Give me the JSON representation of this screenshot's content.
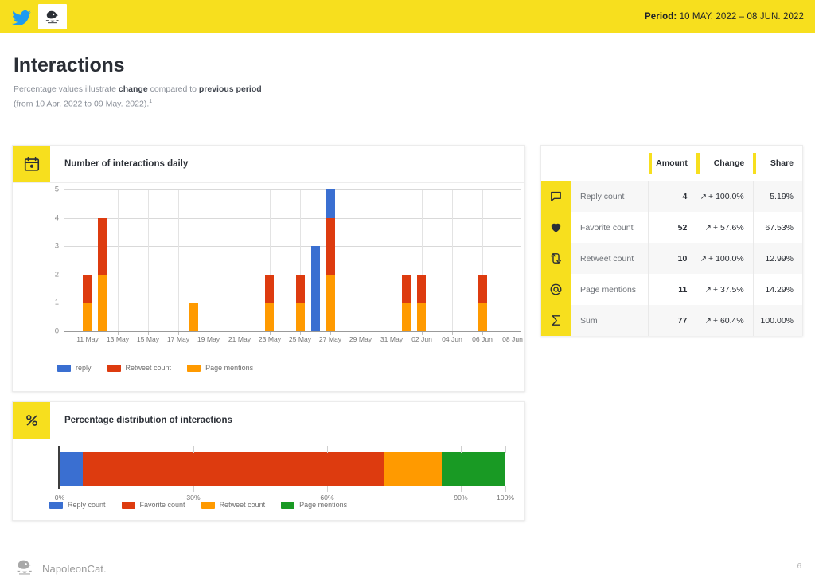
{
  "header": {
    "twitter_icon": "twitter-bird-icon",
    "brand_logo_icon": "napoleoncat-logo-icon",
    "period_label": "Period:",
    "period_value": "10 MAY. 2022 – 08 JUN. 2022"
  },
  "title": {
    "heading": "Interactions",
    "sub_line1_a": "Percentage values illustrate ",
    "sub_line1_b": "change",
    "sub_line1_c": " compared to ",
    "sub_line1_d": "previous period",
    "sub_line2": "(from 10 Apr. 2022 to 09 May. 2022).",
    "footnote_marker": "1"
  },
  "daily_card": {
    "icon": "calendar-icon",
    "title": "Number of interactions daily",
    "legend": [
      {
        "label": "reply",
        "color": "#3a6fd1"
      },
      {
        "label": "Retweet count",
        "color": "#dd3b0f"
      },
      {
        "label": "Page mentions",
        "color": "#ff9a00"
      }
    ]
  },
  "pct_card": {
    "icon": "percent-icon",
    "title": "Percentage distribution of interactions",
    "legend": [
      {
        "label": "Reply count",
        "color": "#3a6fd1"
      },
      {
        "label": "Favorite count",
        "color": "#dd3b0f"
      },
      {
        "label": "Retweet count",
        "color": "#ff9a00"
      },
      {
        "label": "Page mentions",
        "color": "#199a24"
      }
    ]
  },
  "table": {
    "columns": [
      "",
      "",
      "Amount",
      "Change",
      "Share"
    ],
    "rows": [
      {
        "icon": "speech-bubble-icon",
        "label": "Reply count",
        "amount": "4",
        "change": "+ 100.0%",
        "share": "5.19%"
      },
      {
        "icon": "heart-icon",
        "label": "Favorite count",
        "amount": "52",
        "change": "+ 57.6%",
        "share": "67.53%"
      },
      {
        "icon": "retweet-icon",
        "label": "Retweet count",
        "amount": "10",
        "change": "+ 100.0%",
        "share": "12.99%"
      },
      {
        "icon": "at-sign-icon",
        "label": "Page mentions",
        "amount": "11",
        "change": "+ 37.5%",
        "share": "14.29%"
      },
      {
        "icon": "sigma-icon",
        "label": "Sum",
        "amount": "77",
        "change": "+ 60.4%",
        "share": "100.00%"
      }
    ]
  },
  "footer": {
    "logo_icon": "napoleoncat-logo-icon",
    "brand": "NapoleonCat.",
    "page_number": "6"
  },
  "colors": {
    "accent_yellow": "#f7df1e",
    "reply_blue": "#3a6fd1",
    "favorite_red": "#dd3b0f",
    "retweet_orange": "#ff9a00",
    "mention_green": "#199a24"
  },
  "chart_data": [
    {
      "type": "bar",
      "title": "Number of interactions daily",
      "stacked": true,
      "xlabel": "",
      "ylabel": "",
      "ylim": [
        0,
        5
      ],
      "yticks": [
        0,
        1,
        2,
        3,
        4,
        5
      ],
      "grid": true,
      "legend_position": "bottom",
      "x": [
        "11 May",
        "13 May",
        "15 May",
        "17 May",
        "19 May",
        "21 May",
        "23 May",
        "25 May",
        "27 May",
        "29 May",
        "31 May",
        "02 Jun",
        "04 Jun",
        "06 Jun",
        "08 Jun"
      ],
      "categories": [
        "10 May",
        "11 May",
        "12 May",
        "13 May",
        "14 May",
        "15 May",
        "16 May",
        "17 May",
        "18 May",
        "19 May",
        "20 May",
        "21 May",
        "22 May",
        "23 May",
        "24 May",
        "25 May",
        "26 May",
        "27 May",
        "28 May",
        "29 May",
        "30 May",
        "31 May",
        "01 Jun",
        "02 Jun",
        "03 Jun",
        "04 Jun",
        "05 Jun",
        "06 Jun",
        "07 Jun",
        "08 Jun"
      ],
      "series": [
        {
          "name": "reply",
          "color": "#3a6fd1",
          "values": [
            0,
            0,
            0,
            0,
            0,
            0,
            0,
            0,
            0,
            0,
            0,
            0,
            0,
            0,
            0,
            0,
            3,
            1,
            0,
            0,
            0,
            0,
            0,
            0,
            0,
            0,
            0,
            0,
            0,
            0
          ]
        },
        {
          "name": "Retweet count",
          "color": "#dd3b0f",
          "values": [
            0,
            1,
            2,
            0,
            0,
            0,
            0,
            0,
            0,
            0,
            0,
            0,
            0,
            1,
            0,
            1,
            0,
            2,
            0,
            0,
            0,
            0,
            1,
            1,
            0,
            0,
            0,
            1,
            0,
            0
          ]
        },
        {
          "name": "Page mentions",
          "color": "#ff9a00",
          "values": [
            0,
            1,
            2,
            0,
            0,
            0,
            0,
            0,
            1,
            0,
            0,
            0,
            0,
            1,
            0,
            1,
            0,
            2,
            0,
            0,
            0,
            0,
            1,
            1,
            0,
            0,
            0,
            1,
            0,
            0
          ]
        }
      ]
    },
    {
      "type": "bar",
      "orientation": "horizontal",
      "stacked": true,
      "title": "Percentage distribution of interactions",
      "xlim": [
        0,
        100
      ],
      "xticks": [
        0,
        30,
        60,
        90,
        100
      ],
      "xtick_labels": [
        "0%",
        "30%",
        "60%",
        "90%",
        "100%"
      ],
      "legend_position": "bottom",
      "categories": [
        "Reply count",
        "Favorite count",
        "Retweet count",
        "Page mentions"
      ],
      "values": [
        5.19,
        67.53,
        12.99,
        14.29
      ],
      "colors": [
        "#3a6fd1",
        "#dd3b0f",
        "#ff9a00",
        "#199a24"
      ]
    }
  ]
}
